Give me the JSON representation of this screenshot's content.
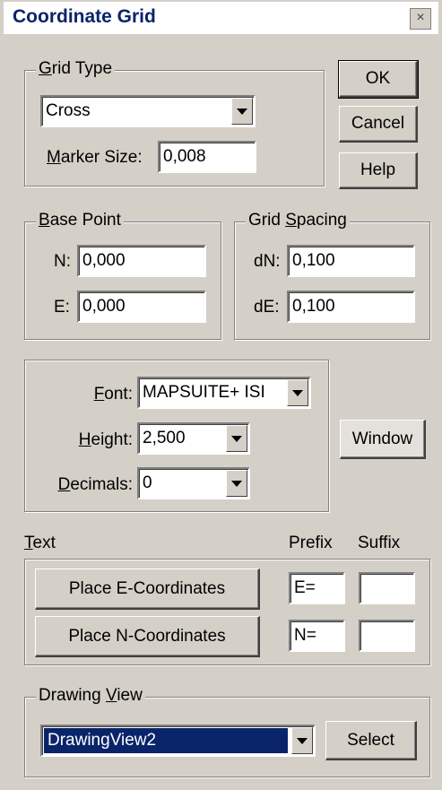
{
  "window": {
    "title": "Coordinate Grid",
    "close_glyph": "×"
  },
  "grid_type": {
    "legend_mnemonic": "G",
    "legend_rest": "rid Type",
    "type_value": "Cross",
    "marker_label_mnemonic": "M",
    "marker_label_rest": "arker Size:",
    "marker_size": "0,008"
  },
  "buttons": {
    "ok": "OK",
    "cancel": "Cancel",
    "help": "Help",
    "window": "Window"
  },
  "base_point": {
    "legend_mnemonic": "B",
    "legend_rest": "ase Point",
    "n_label": "N:",
    "n_value": "0,000",
    "e_label": "E:",
    "e_value": "0,000"
  },
  "grid_spacing": {
    "legend_pre": "Grid ",
    "legend_mnemonic": "S",
    "legend_rest": "pacing",
    "dn_label": "dN:",
    "dn_value": "0,100",
    "de_label": "dE:",
    "de_value": "0,100"
  },
  "font_group": {
    "font_mnemonic": "F",
    "font_rest": "ont:",
    "font_value": "MAPSUITE+ ISI",
    "height_mnemonic": "H",
    "height_rest": "eight:",
    "height_value": "2,500",
    "decimals_mnemonic": "D",
    "decimals_rest": "ecimals:",
    "decimals_value": "0"
  },
  "text_section": {
    "label_mnemonic": "T",
    "label_rest": "ext",
    "prefix_header": "Prefix",
    "suffix_header": "Suffix",
    "place_e_label": "Place E-Coordinates",
    "place_n_label": "Place N-Coordinates",
    "e_prefix": "E=",
    "e_suffix": "",
    "n_prefix": "N=",
    "n_suffix": ""
  },
  "drawing_view": {
    "legend_pre": "Drawing ",
    "legend_mnemonic": "V",
    "legend_rest": "iew",
    "selected": "DrawingView2",
    "select_label": "Select"
  },
  "colors": {
    "title_text": "#0a246a",
    "dialog_bg": "#d4d0c8",
    "selection": "#0a246a"
  }
}
